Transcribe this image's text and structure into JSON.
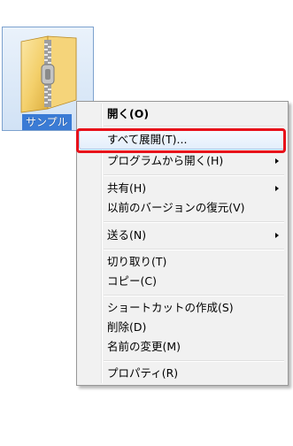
{
  "desktop_file": {
    "label": "サンプル",
    "icon": "zip-folder-icon"
  },
  "context_menu": {
    "items": [
      {
        "label": "開く(O)",
        "bold": true
      },
      {
        "label": "すべて展開(T)...",
        "highlighted": true
      },
      {
        "label": "プログラムから開く(H)",
        "submenu": true
      },
      {
        "label": "共有(H)",
        "submenu": true
      },
      {
        "label": "以前のバージョンの復元(V)"
      },
      {
        "label": "送る(N)",
        "submenu": true
      },
      {
        "label": "切り取り(T)"
      },
      {
        "label": "コピー(C)"
      },
      {
        "label": "ショートカットの作成(S)"
      },
      {
        "label": "削除(D)"
      },
      {
        "label": "名前の変更(M)"
      },
      {
        "label": "プロパティ(R)"
      }
    ]
  },
  "annotation": {
    "color": "#e8101a"
  }
}
